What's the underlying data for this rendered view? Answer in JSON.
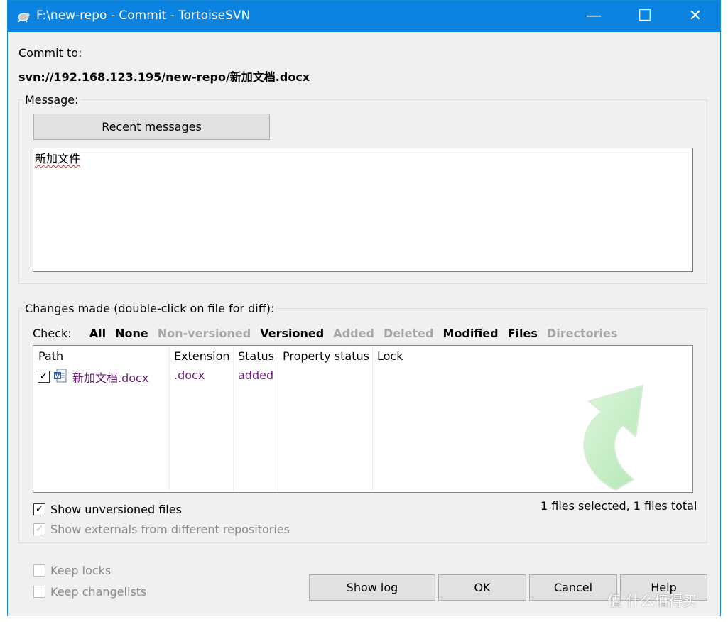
{
  "window": {
    "title": "F:\\new-repo - Commit - TortoiseSVN",
    "minimize": "—",
    "maximize": "☐",
    "close": "✕"
  },
  "commit_to": {
    "label": "Commit to:",
    "url": "svn://192.168.123.195/new-repo/新加文档.docx"
  },
  "message": {
    "group_label": "Message:",
    "recent_button": "Recent messages",
    "text": "新加文件"
  },
  "changes": {
    "group_label": "Changes made (double-click on file for diff):",
    "check_label": "Check:",
    "filters": [
      {
        "label": "All",
        "enabled": true
      },
      {
        "label": "None",
        "enabled": true
      },
      {
        "label": "Non-versioned",
        "enabled": false
      },
      {
        "label": "Versioned",
        "enabled": true
      },
      {
        "label": "Added",
        "enabled": false
      },
      {
        "label": "Deleted",
        "enabled": false
      },
      {
        "label": "Modified",
        "enabled": true
      },
      {
        "label": "Files",
        "enabled": true
      },
      {
        "label": "Directories",
        "enabled": false
      }
    ],
    "columns": [
      "Path",
      "Extension",
      "Status",
      "Property status",
      "Lock"
    ],
    "rows": [
      {
        "checked": true,
        "path": "新加文档.docx",
        "extension": ".docx",
        "status": "added",
        "property_status": "",
        "lock": ""
      }
    ],
    "file_icon": "word-document-icon",
    "show_unversioned": "Show unversioned files",
    "show_externals": "Show externals from different repositories",
    "summary": "1 files selected, 1 files total"
  },
  "footer": {
    "keep_locks": "Keep locks",
    "keep_changelists": "Keep changelists",
    "show_log": "Show log",
    "ok": "OK",
    "cancel": "Cancel",
    "help": "Help"
  },
  "watermark": "值 什么值得买",
  "colors": {
    "titlebar": "#0a84e0",
    "added_text": "#6b1d77",
    "disabled_text": "#a6a6a6"
  }
}
